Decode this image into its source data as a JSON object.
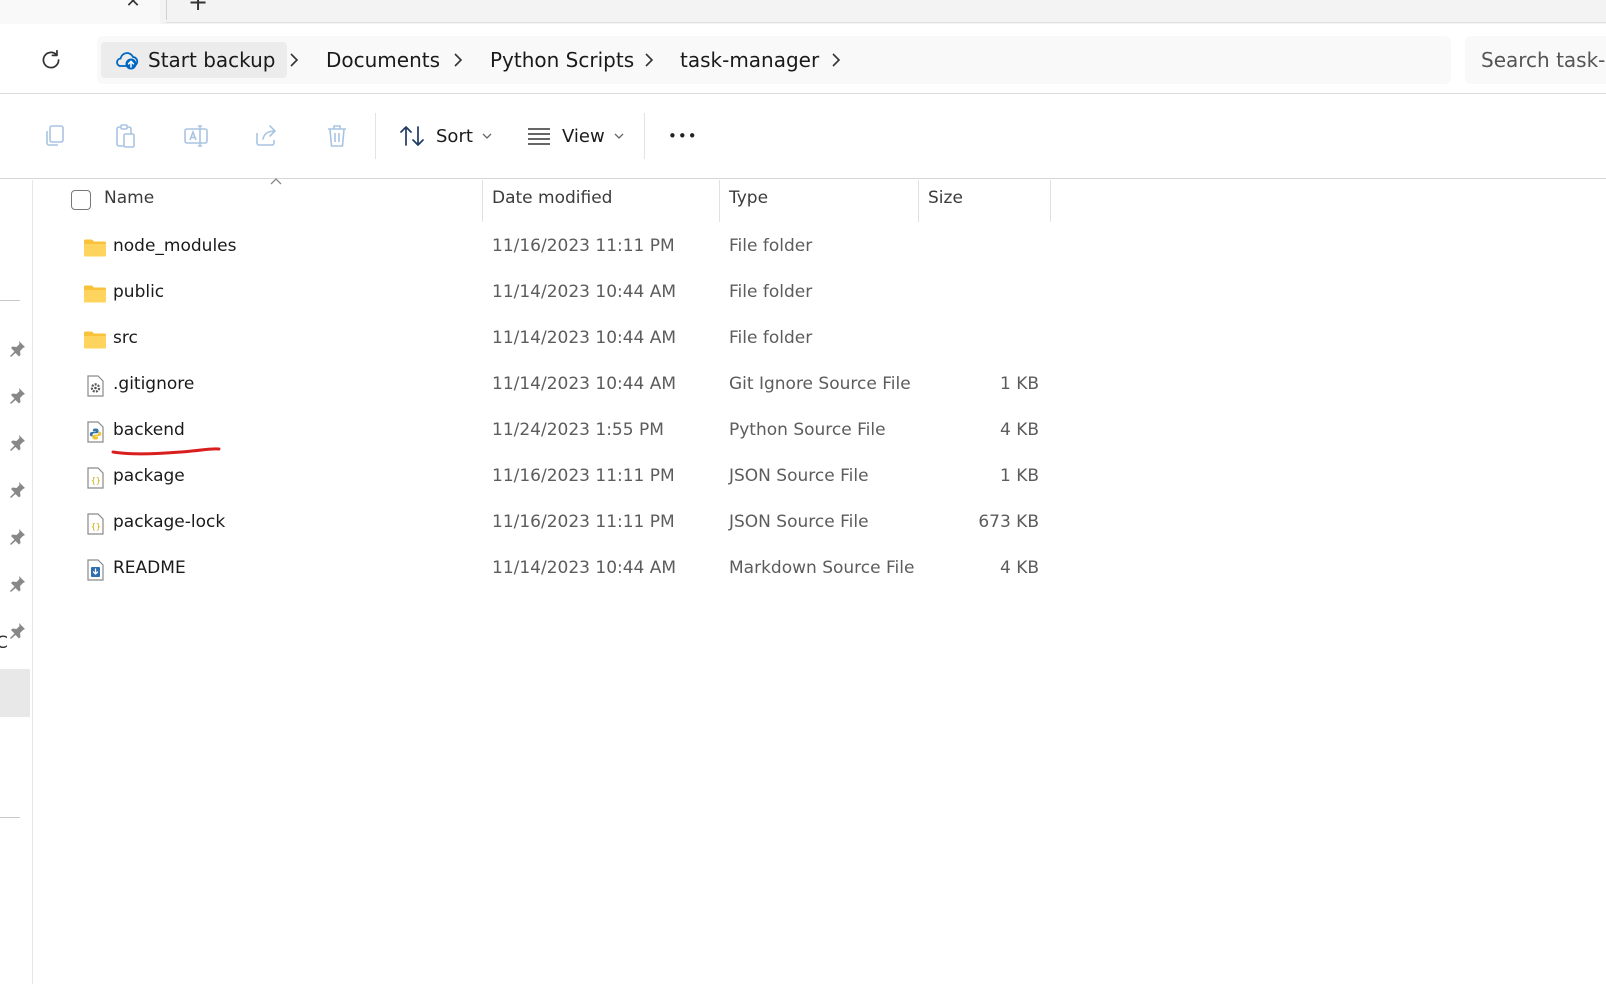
{
  "tabs": {
    "close_glyph": "✕",
    "new_glyph": "+"
  },
  "breadcrumb": {
    "home_label": "Start backup",
    "items": [
      "Documents",
      "Python Scripts",
      "task-manager"
    ]
  },
  "search": {
    "placeholder": "Search task-manager"
  },
  "toolbar": {
    "sort_label": "Sort",
    "view_label": "View",
    "more_glyph": "•••",
    "icons": [
      "copy-icon",
      "paste-icon",
      "rename-icon",
      "share-icon",
      "delete-icon"
    ]
  },
  "nav": {
    "partial_label": "C",
    "pinned_count": 7
  },
  "columns": {
    "name": "Name",
    "date": "Date modified",
    "type": "Type",
    "size": "Size"
  },
  "files": [
    {
      "name": "node_modules",
      "date": "11/16/2023 11:11 PM",
      "type": "File folder",
      "size": "",
      "icon": "folder-icon"
    },
    {
      "name": "public",
      "date": "11/14/2023 10:44 AM",
      "type": "File folder",
      "size": "",
      "icon": "folder-icon"
    },
    {
      "name": "src",
      "date": "11/14/2023 10:44 AM",
      "type": "File folder",
      "size": "",
      "icon": "folder-icon"
    },
    {
      "name": ".gitignore",
      "date": "11/14/2023 10:44 AM",
      "type": "Git Ignore Source File",
      "size": "1 KB",
      "icon": "settings-file-icon"
    },
    {
      "name": "backend",
      "date": "11/24/2023 1:55 PM",
      "type": "Python Source File",
      "size": "4 KB",
      "icon": "python-file-icon"
    },
    {
      "name": "package",
      "date": "11/16/2023 11:11 PM",
      "type": "JSON Source File",
      "size": "1 KB",
      "icon": "json-file-icon"
    },
    {
      "name": "package-lock",
      "date": "11/16/2023 11:11 PM",
      "type": "JSON Source File",
      "size": "673 KB",
      "icon": "json-file-icon"
    },
    {
      "name": "README",
      "date": "11/14/2023 10:44 AM",
      "type": "Markdown Source File",
      "size": "4 KB",
      "icon": "markdown-file-icon"
    }
  ],
  "colors": {
    "accent": "#0067c0",
    "folder": "#f8c33a",
    "annotation": "#d81e1e"
  }
}
